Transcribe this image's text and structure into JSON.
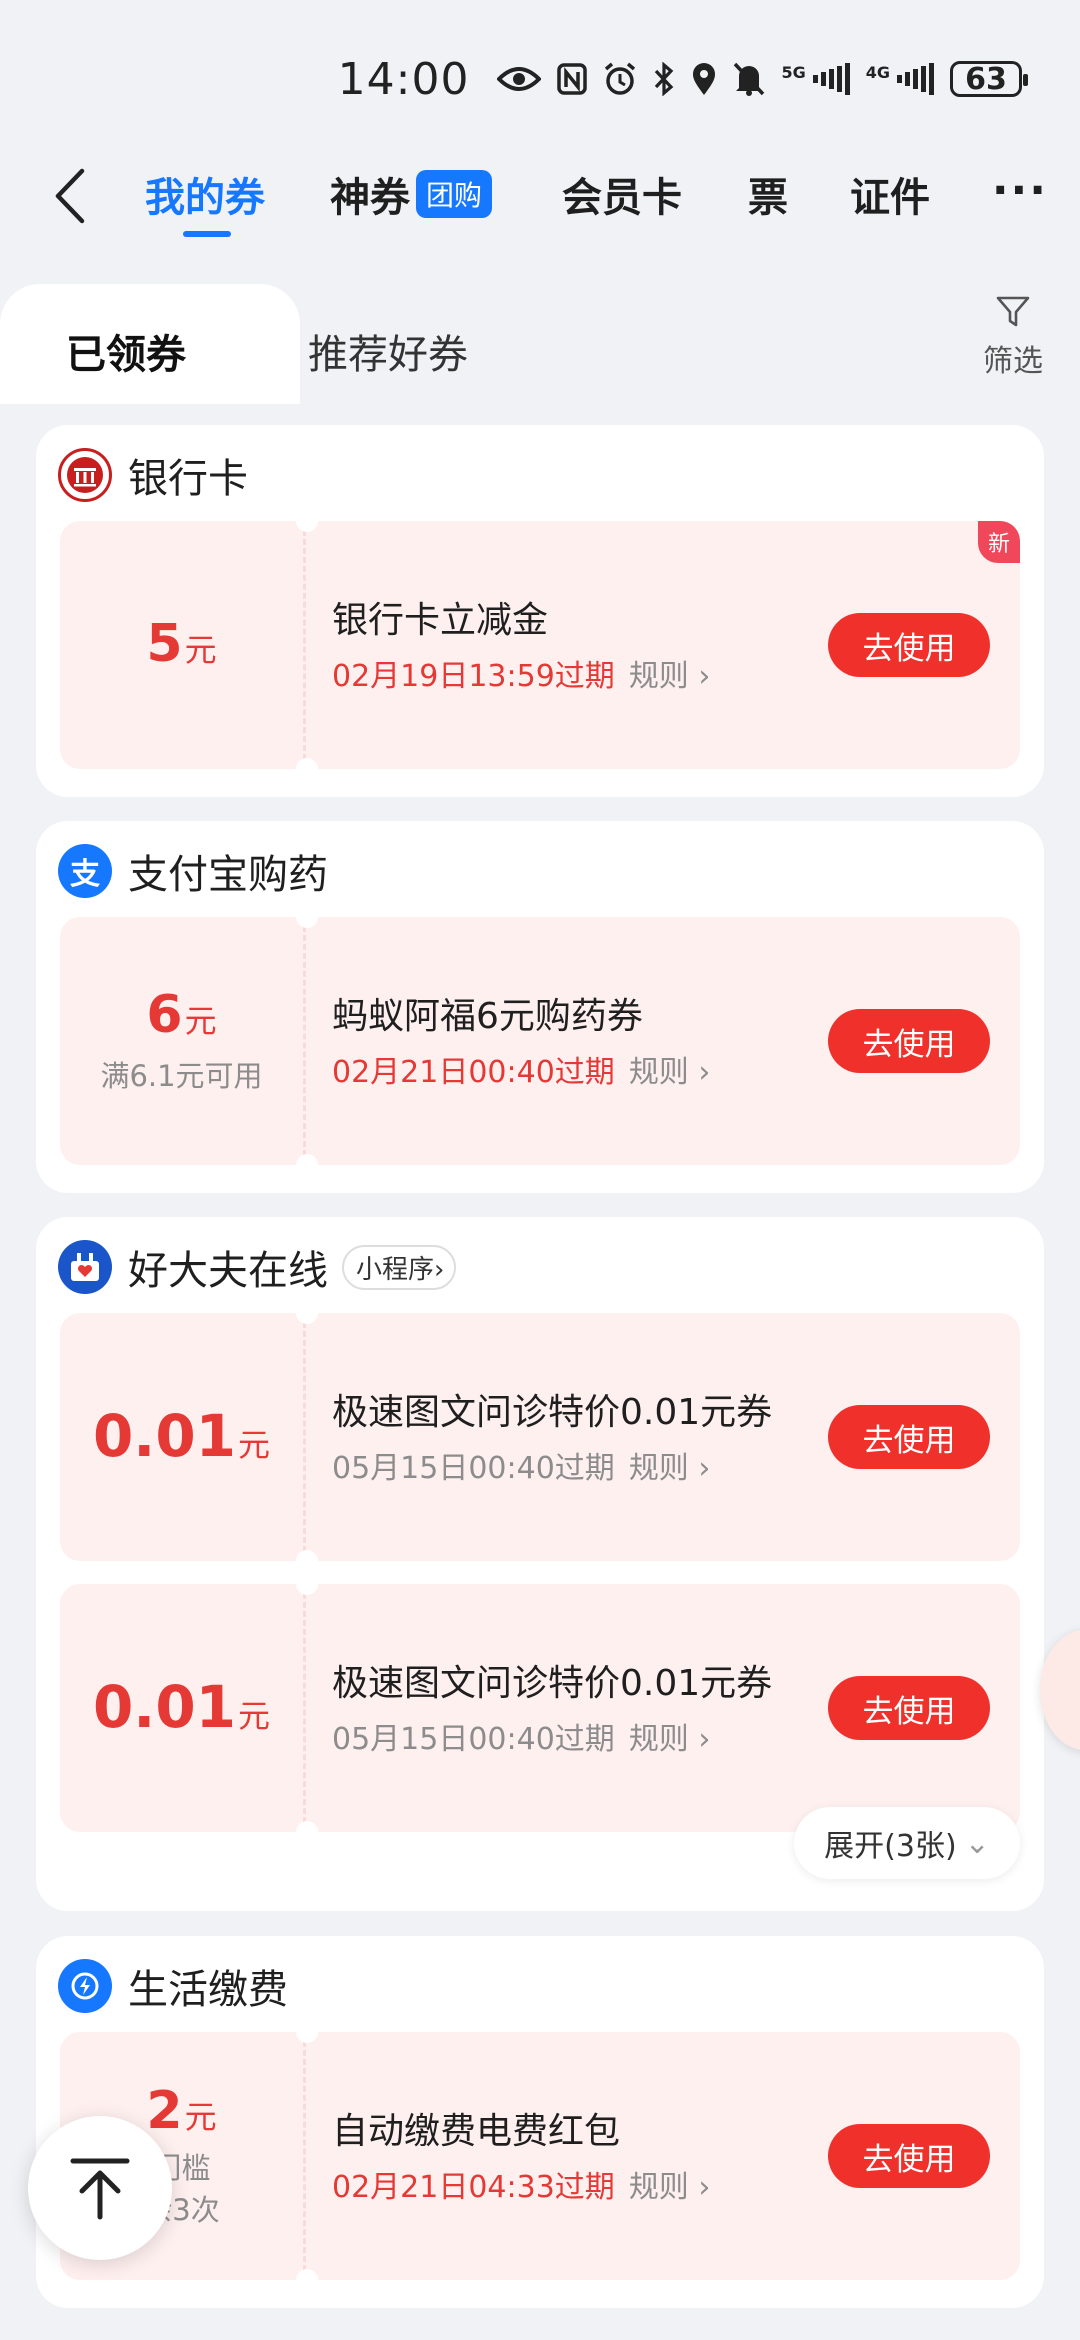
{
  "status_bar": {
    "time": "14:00",
    "battery": "63"
  },
  "nav": {
    "tabs": [
      "我的券",
      "神券",
      "会员卡",
      "票",
      "证件"
    ],
    "group_badge": "团购",
    "more": "···"
  },
  "subtabs": {
    "active": "已领券",
    "inactive": "推荐好券",
    "filter": "筛选"
  },
  "sections": [
    {
      "title": "银行卡",
      "coupons": [
        {
          "amount": "5",
          "unit": "元",
          "name": "银行卡立减金",
          "expire": "02月19日13:59过期",
          "rule": "规则",
          "button": "去使用",
          "badge": "新"
        }
      ]
    },
    {
      "title": "支付宝购药",
      "coupons": [
        {
          "amount": "6",
          "unit": "元",
          "condition": "满6.1元可用",
          "name": "蚂蚁阿福6元购药券",
          "expire": "02月21日00:40过期",
          "rule": "规则",
          "button": "去使用"
        }
      ]
    },
    {
      "title": "好大夫在线",
      "tag": "小程序",
      "coupons": [
        {
          "amount": "0.01",
          "unit": "元",
          "name": "极速图文问诊特价0.01元券",
          "expire": "05月15日00:40过期",
          "rule": "规则",
          "button": "去使用"
        },
        {
          "amount": "0.01",
          "unit": "元",
          "name": "极速图文问诊特价0.01元券",
          "expire": "05月15日00:40过期",
          "rule": "规则",
          "button": "去使用"
        }
      ],
      "expand": "展开(3张)"
    },
    {
      "title": "生活缴费",
      "coupons": [
        {
          "amount": "2",
          "unit": "元",
          "condition": "门槛",
          "condition2": "余3次",
          "name": "自动缴费电费红包",
          "expire": "02月21日04:33过期",
          "rule": "规则",
          "button": "去使用"
        }
      ]
    }
  ],
  "colors": {
    "accent": "#1677ff",
    "red": "#e53935",
    "button": "#f0302a",
    "coupon_bg": "#fff0f0"
  },
  "icons": [
    "back-arrow-icon",
    "eye-icon",
    "nfc-icon",
    "alarm-icon",
    "bluetooth-icon",
    "location-icon",
    "mute-icon",
    "signal-icon",
    "filter-icon",
    "bank-icon",
    "alipay-icon",
    "haodf-icon",
    "bolt-icon",
    "chevron-right-icon",
    "chevron-down-icon",
    "back-to-top-icon"
  ]
}
